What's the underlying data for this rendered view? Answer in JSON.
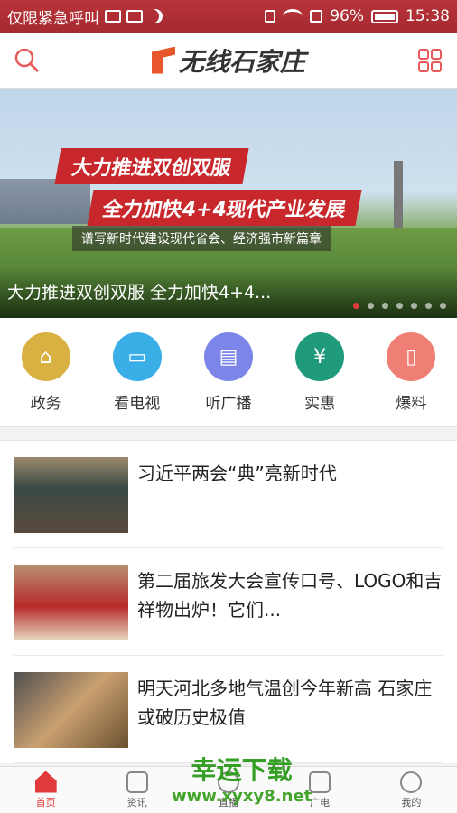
{
  "status_bar": {
    "carrier": "仅限紧急呼叫",
    "battery": "96%",
    "time": "15:38"
  },
  "header": {
    "logo_text": "无线石家庄"
  },
  "banner": {
    "headline1": "大力推进双创双服",
    "headline2": "全力加快4+4现代产业发展",
    "headline3": "谱写新时代建设现代省会、经济强市新篇章",
    "caption": "大力推进双创双服 全力加快4+4..."
  },
  "shortcuts": [
    {
      "label": "政务",
      "color": "#d9b142",
      "icon": "house-icon"
    },
    {
      "label": "看电视",
      "color": "#3aaee6",
      "icon": "tv-icon"
    },
    {
      "label": "听广播",
      "color": "#7b86e8",
      "icon": "radio-icon"
    },
    {
      "label": "实惠",
      "color": "#1f9a7a",
      "icon": "moneybag-icon"
    },
    {
      "label": "爆料",
      "color": "#ef7f74",
      "icon": "book-icon"
    }
  ],
  "news": [
    {
      "title": "习近平两会“典”亮新时代"
    },
    {
      "title": "第二届旅发大会宣传口号、LOGO和吉祥物出炉！它们..."
    },
    {
      "title": "明天河北多地气温创今年新高 石家庄或破历史极值"
    }
  ],
  "tabs": [
    {
      "label": "首页"
    },
    {
      "label": "资讯"
    },
    {
      "label": "直播"
    },
    {
      "label": "广电"
    },
    {
      "label": "我的"
    }
  ],
  "watermark": {
    "line1": "幸运下载",
    "line2": "www.xyxy8.net"
  }
}
